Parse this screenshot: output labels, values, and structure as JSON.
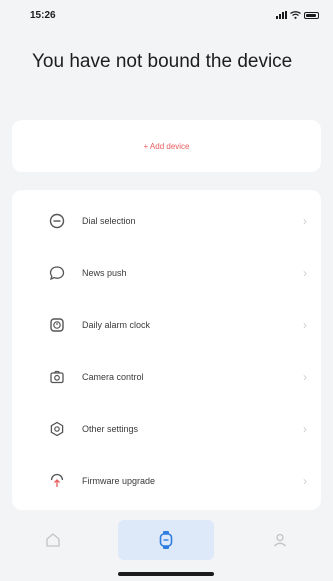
{
  "status_bar": {
    "time": "15:26"
  },
  "title": "You have not bound the device",
  "add_device": {
    "label": "+ Add device"
  },
  "menu": {
    "items": [
      {
        "label": "Dial selection",
        "icon": "dial-icon"
      },
      {
        "label": "News push",
        "icon": "message-icon"
      },
      {
        "label": "Daily alarm clock",
        "icon": "alarm-icon"
      },
      {
        "label": "Camera control",
        "icon": "camera-icon"
      },
      {
        "label": "Other settings",
        "icon": "settings-icon"
      },
      {
        "label": "Firmware upgrade",
        "icon": "upgrade-icon"
      }
    ]
  },
  "tab_bar": {
    "tabs": [
      {
        "icon": "home-icon",
        "active": false
      },
      {
        "icon": "watch-icon",
        "active": true
      },
      {
        "icon": "profile-icon",
        "active": false
      }
    ]
  },
  "colors": {
    "background": "#f3f4f6",
    "accent": "#e85b5b",
    "active_tab": "#dde8f8",
    "icon": "#555555"
  }
}
